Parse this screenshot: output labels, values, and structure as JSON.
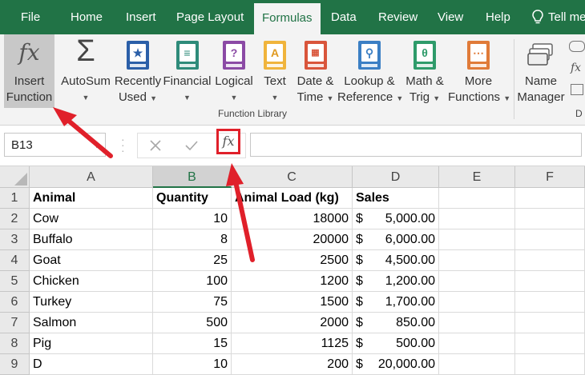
{
  "tabs": [
    "File",
    "Home",
    "Insert",
    "Page Layout",
    "Formulas",
    "Data",
    "Review",
    "View",
    "Help",
    "Tell me"
  ],
  "active_tab": "Formulas",
  "ribbon": {
    "insert_function": {
      "line1": "Insert",
      "line2": "Function"
    },
    "autosum": "AutoSum",
    "recently_used": {
      "line1": "Recently",
      "line2": "Used"
    },
    "financial": "Financial",
    "logical": "Logical",
    "text": "Text",
    "date_time": {
      "line1": "Date &",
      "line2": "Time"
    },
    "lookup_reference": {
      "line1": "Lookup &",
      "line2": "Reference"
    },
    "math_trig": {
      "line1": "Math &",
      "line2": "Trig"
    },
    "more_functions": {
      "line1": "More",
      "line2": "Functions"
    },
    "name_manager": {
      "line1": "Name",
      "line2": "Manager"
    },
    "group_label": "Function Library",
    "group_label_2": "D",
    "icon_labels": {
      "logical": "?",
      "text": "A",
      "math": "θ"
    },
    "colors": {
      "accent": "#217346",
      "financial": "#2e8b7a",
      "logical": "#8b4aa5",
      "text": "#f0b43c",
      "date": "#d9553b",
      "lookup": "#3b7fc4",
      "math": "#2e9b6a",
      "more": "#e07b39",
      "recent": "#2b5fa8"
    }
  },
  "formula_bar": {
    "name_box": "B13",
    "formula": ""
  },
  "grid": {
    "columns": [
      "A",
      "B",
      "C",
      "D",
      "E",
      "F"
    ],
    "rows": [
      "1",
      "2",
      "3",
      "4",
      "5",
      "6",
      "7",
      "8",
      "9"
    ],
    "header": {
      "animal": "Animal",
      "quantity": "Quantity",
      "load": "Animal Load (kg)",
      "sales": "Sales"
    },
    "currency": "$",
    "data": [
      {
        "animal": "Cow",
        "quantity": "10",
        "load": "18000",
        "sales": "5,000.00"
      },
      {
        "animal": "Buffalo",
        "quantity": "8",
        "load": "20000",
        "sales": "6,000.00"
      },
      {
        "animal": "Goat",
        "quantity": "25",
        "load": "2500",
        "sales": "4,500.00"
      },
      {
        "animal": "Chicken",
        "quantity": "100",
        "load": "1200",
        "sales": "1,200.00"
      },
      {
        "animal": "Turkey",
        "quantity": "75",
        "load": "1500",
        "sales": "1,700.00"
      },
      {
        "animal": "Salmon",
        "quantity": "500",
        "load": "2000",
        "sales": "850.00"
      },
      {
        "animal": "Pig",
        "quantity": "15",
        "load": "1125",
        "sales": "500.00"
      },
      {
        "animal": "D",
        "quantity": "10",
        "load": "200",
        "sales": "20,000.00"
      }
    ]
  }
}
